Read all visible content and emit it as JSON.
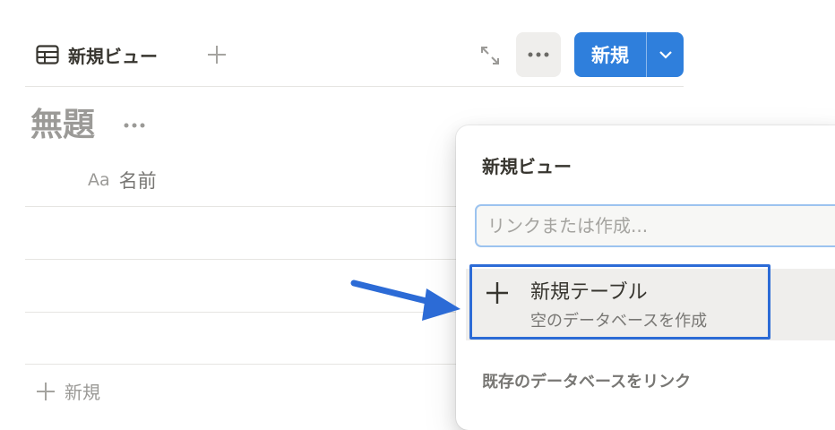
{
  "toolbar": {
    "view_tab_label": "新規ビュー",
    "new_button_label": "新規",
    "accent_color": "#2f7fdc"
  },
  "database": {
    "title": "無題",
    "column_type_label": "Aa",
    "column_name": "名前",
    "add_row_label": "新規"
  },
  "popup": {
    "title": "新規ビュー",
    "search_placeholder": "リンクまたは作成...",
    "option": {
      "title": "新規テーブル",
      "subtitle": "空のデータベースを作成"
    },
    "link_existing_label": "既存のデータベースをリンク"
  },
  "annotation": {
    "highlight_color": "#2c6bd6"
  }
}
